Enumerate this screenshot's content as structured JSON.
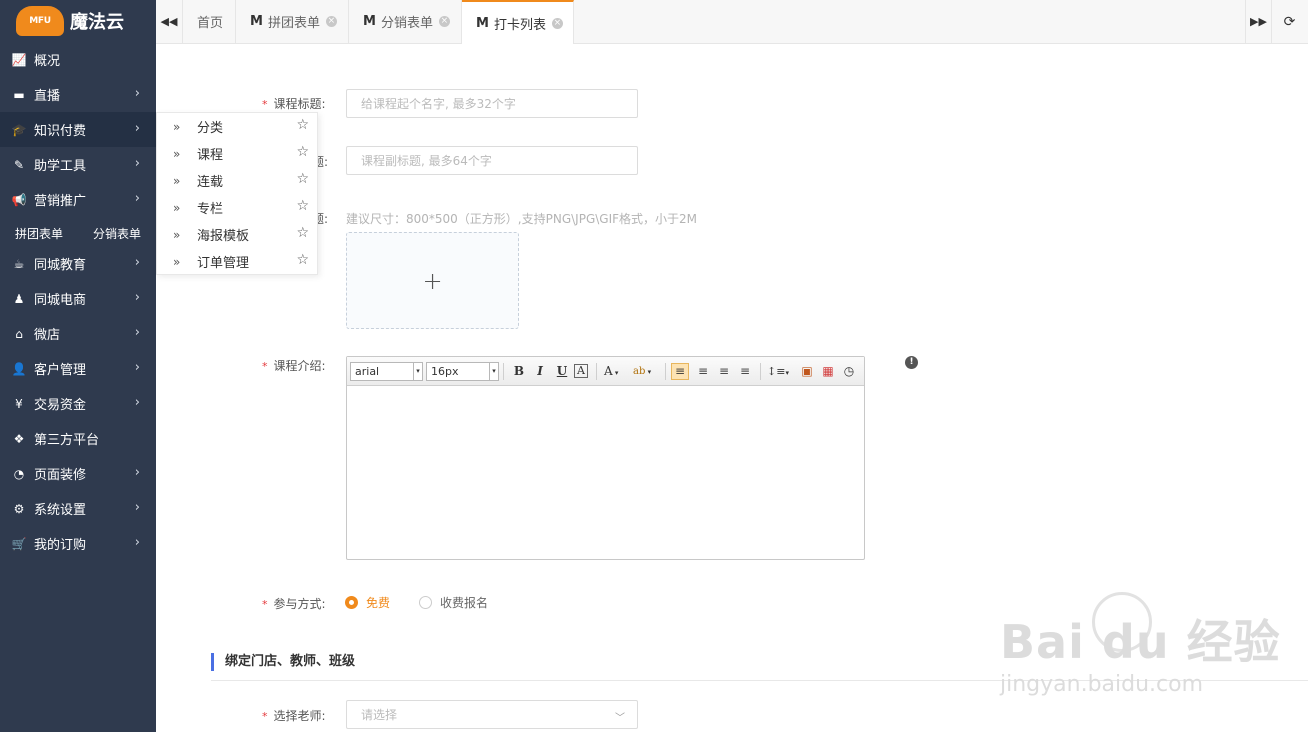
{
  "app": {
    "logo_text": "MFU",
    "brand": "魔法云"
  },
  "sidebar": {
    "items": [
      {
        "icon": "chart-line-icon",
        "glyph": "📈",
        "label": "概况",
        "arrow": false
      },
      {
        "icon": "video-icon",
        "glyph": "▬",
        "label": "直播",
        "arrow": true
      },
      {
        "icon": "graduation-cap-icon",
        "glyph": "🎓",
        "label": "知识付费",
        "arrow": true
      },
      {
        "icon": "eraser-icon",
        "glyph": "✎",
        "label": "助学工具",
        "arrow": true
      },
      {
        "icon": "bullhorn-icon",
        "glyph": "📢",
        "label": "营销推广",
        "arrow": true
      },
      {
        "icon": "coffee-icon",
        "glyph": "☕",
        "label": "同城教育",
        "arrow": true
      },
      {
        "icon": "joystick-icon",
        "glyph": "♟",
        "label": "同城电商",
        "arrow": true
      },
      {
        "icon": "home-icon",
        "glyph": "⌂",
        "label": "微店",
        "arrow": true
      },
      {
        "icon": "user-icon",
        "glyph": "👤",
        "label": "客户管理",
        "arrow": true
      },
      {
        "icon": "yen-icon",
        "glyph": "¥",
        "label": "交易资金",
        "arrow": true
      },
      {
        "icon": "cubes-icon",
        "glyph": "❖",
        "label": "第三方平台",
        "arrow": false
      },
      {
        "icon": "dashboard-icon",
        "glyph": "◔",
        "label": "页面装修",
        "arrow": true
      },
      {
        "icon": "gear-icon",
        "glyph": "⚙",
        "label": "系统设置",
        "arrow": true
      },
      {
        "icon": "cart-icon",
        "glyph": "🛒",
        "label": "我的订购",
        "arrow": true
      }
    ],
    "quick_links": [
      "拼团表单",
      "分销表单"
    ],
    "arrow_glyph": "›"
  },
  "flyout": {
    "items": [
      "分类",
      "课程",
      "连载",
      "专栏",
      "海报模板",
      "订单管理"
    ],
    "dbl_glyph": "»",
    "star_glyph": "☆"
  },
  "tabs": {
    "prev_glyph": "◀◀",
    "next_glyph": "▶▶",
    "refresh_glyph": "⟳",
    "items": [
      {
        "label": "首页",
        "m": "",
        "closable": false
      },
      {
        "label": "拼团表单",
        "m": "M",
        "closable": true
      },
      {
        "label": "分销表单",
        "m": "M",
        "closable": true
      },
      {
        "label": "打卡列表",
        "m": "M",
        "closable": true
      }
    ],
    "close_glyph": "×"
  },
  "form": {
    "title_label": "课程标题:",
    "title_placeholder": "给课程起个名字, 最多32个字",
    "subtitle_label": "题:",
    "subtitle_placeholder": "课程副标题, 最多64个字",
    "cover_label": "题:",
    "cover_hint": "建议尺寸：800*500（正方形）,支持PNG\\JPG\\GIF格式，小于2M",
    "upload_glyph": "+",
    "intro_label": "课程介绍:",
    "required_mark": "*",
    "info_glyph": "!",
    "editor": {
      "font": "arial",
      "size": "16px",
      "buttons": [
        "B",
        "I",
        "U",
        "A",
        "A",
        "ab",
        "≡",
        "≡",
        "≡",
        "≡",
        "↕≡",
        "▣",
        "▦",
        "◷"
      ]
    },
    "participation_label": "参与方式:",
    "options": [
      {
        "label": "免费",
        "selected": true
      },
      {
        "label": "收费报名",
        "selected": false
      }
    ],
    "section_title": "绑定门店、教师、班级",
    "teacher_label": "选择老师:",
    "teacher_placeholder": "请选择",
    "chevron_glyph": "﹀"
  },
  "watermark": {
    "brand": "Bai du 经验",
    "url": "jingyan.baidu.com"
  },
  "colors": {
    "sidebar": "#2f3a4e",
    "accent": "#f08a1c",
    "section_bar": "#4a6fe3"
  }
}
